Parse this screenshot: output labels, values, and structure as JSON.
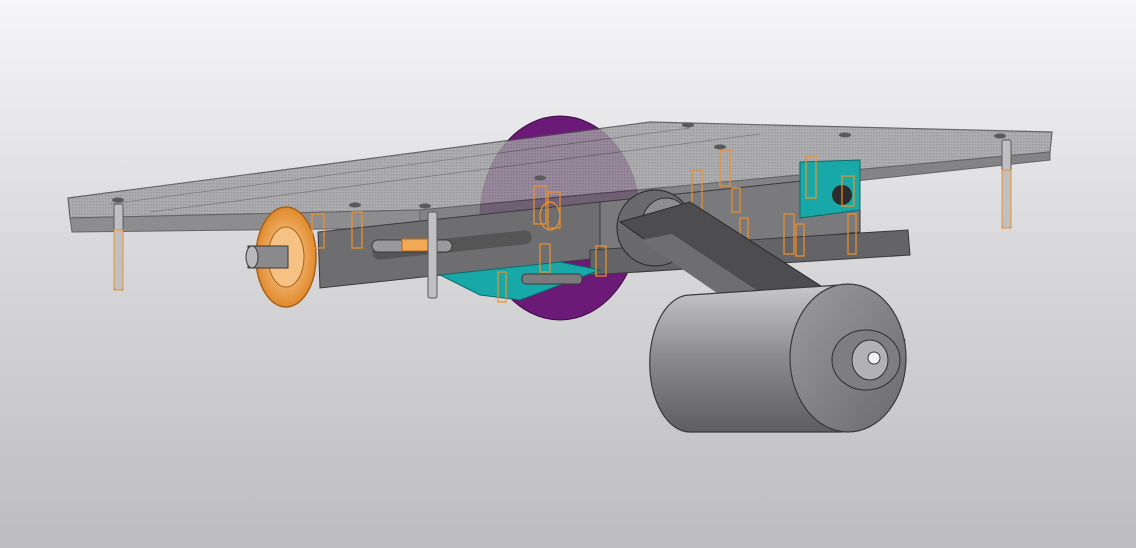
{
  "viewport": {
    "background_top": "#f6f6f8",
    "background_bottom": "#bdbdc0"
  },
  "model": {
    "part_colors": {
      "frame_plate": "#9a9a9c",
      "frame_edge": "#5a5a5c",
      "chassis_body": "#6e6e70",
      "purple_disc": "#6b1a78",
      "teal_bracket": "#19a8a8",
      "orange_gear": "#f2a955",
      "roller": "#8f8f91",
      "belt": "#4d4d4f",
      "highlight_outline": "#f0902a"
    },
    "icons": [
      "cad-assembly-model"
    ]
  }
}
